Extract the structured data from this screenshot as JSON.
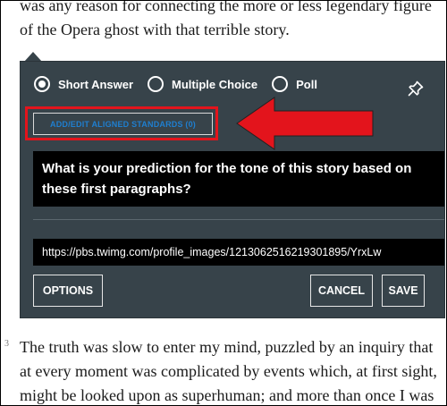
{
  "article": {
    "paragraph_top": "was any reason for connecting the more or less legendary figure of the Opera ghost with that terrible story.",
    "paragraph_number": "3",
    "paragraph_bottom": "The truth was slow to enter my mind, puzzled by an inquiry that at every moment was complicated by events which, at first sight, might be looked upon as superhuman; and more than once I was"
  },
  "question_panel": {
    "types": [
      {
        "label": "Short Answer",
        "selected": true
      },
      {
        "label": "Multiple Choice",
        "selected": false
      },
      {
        "label": "Poll",
        "selected": false
      }
    ],
    "standards_button": "ADD/EDIT ALIGNED STANDARDS (0)",
    "question_text": "What is your prediction for the tone of this story based on these first paragraphs?",
    "image_url": "https://pbs.twimg.com/profile_images/1213062516219301895/YrxLw",
    "buttons": {
      "options": "OPTIONS",
      "cancel": "CANCEL",
      "save": "SAVE"
    }
  },
  "colors": {
    "panel_bg": "#37434a",
    "accent_blue": "#1f7fd0",
    "annotation_red": "#e3141c"
  },
  "icons": [
    "pin-icon",
    "radio-selected-icon",
    "radio-unselected-icon",
    "red-arrow-annotation"
  ]
}
